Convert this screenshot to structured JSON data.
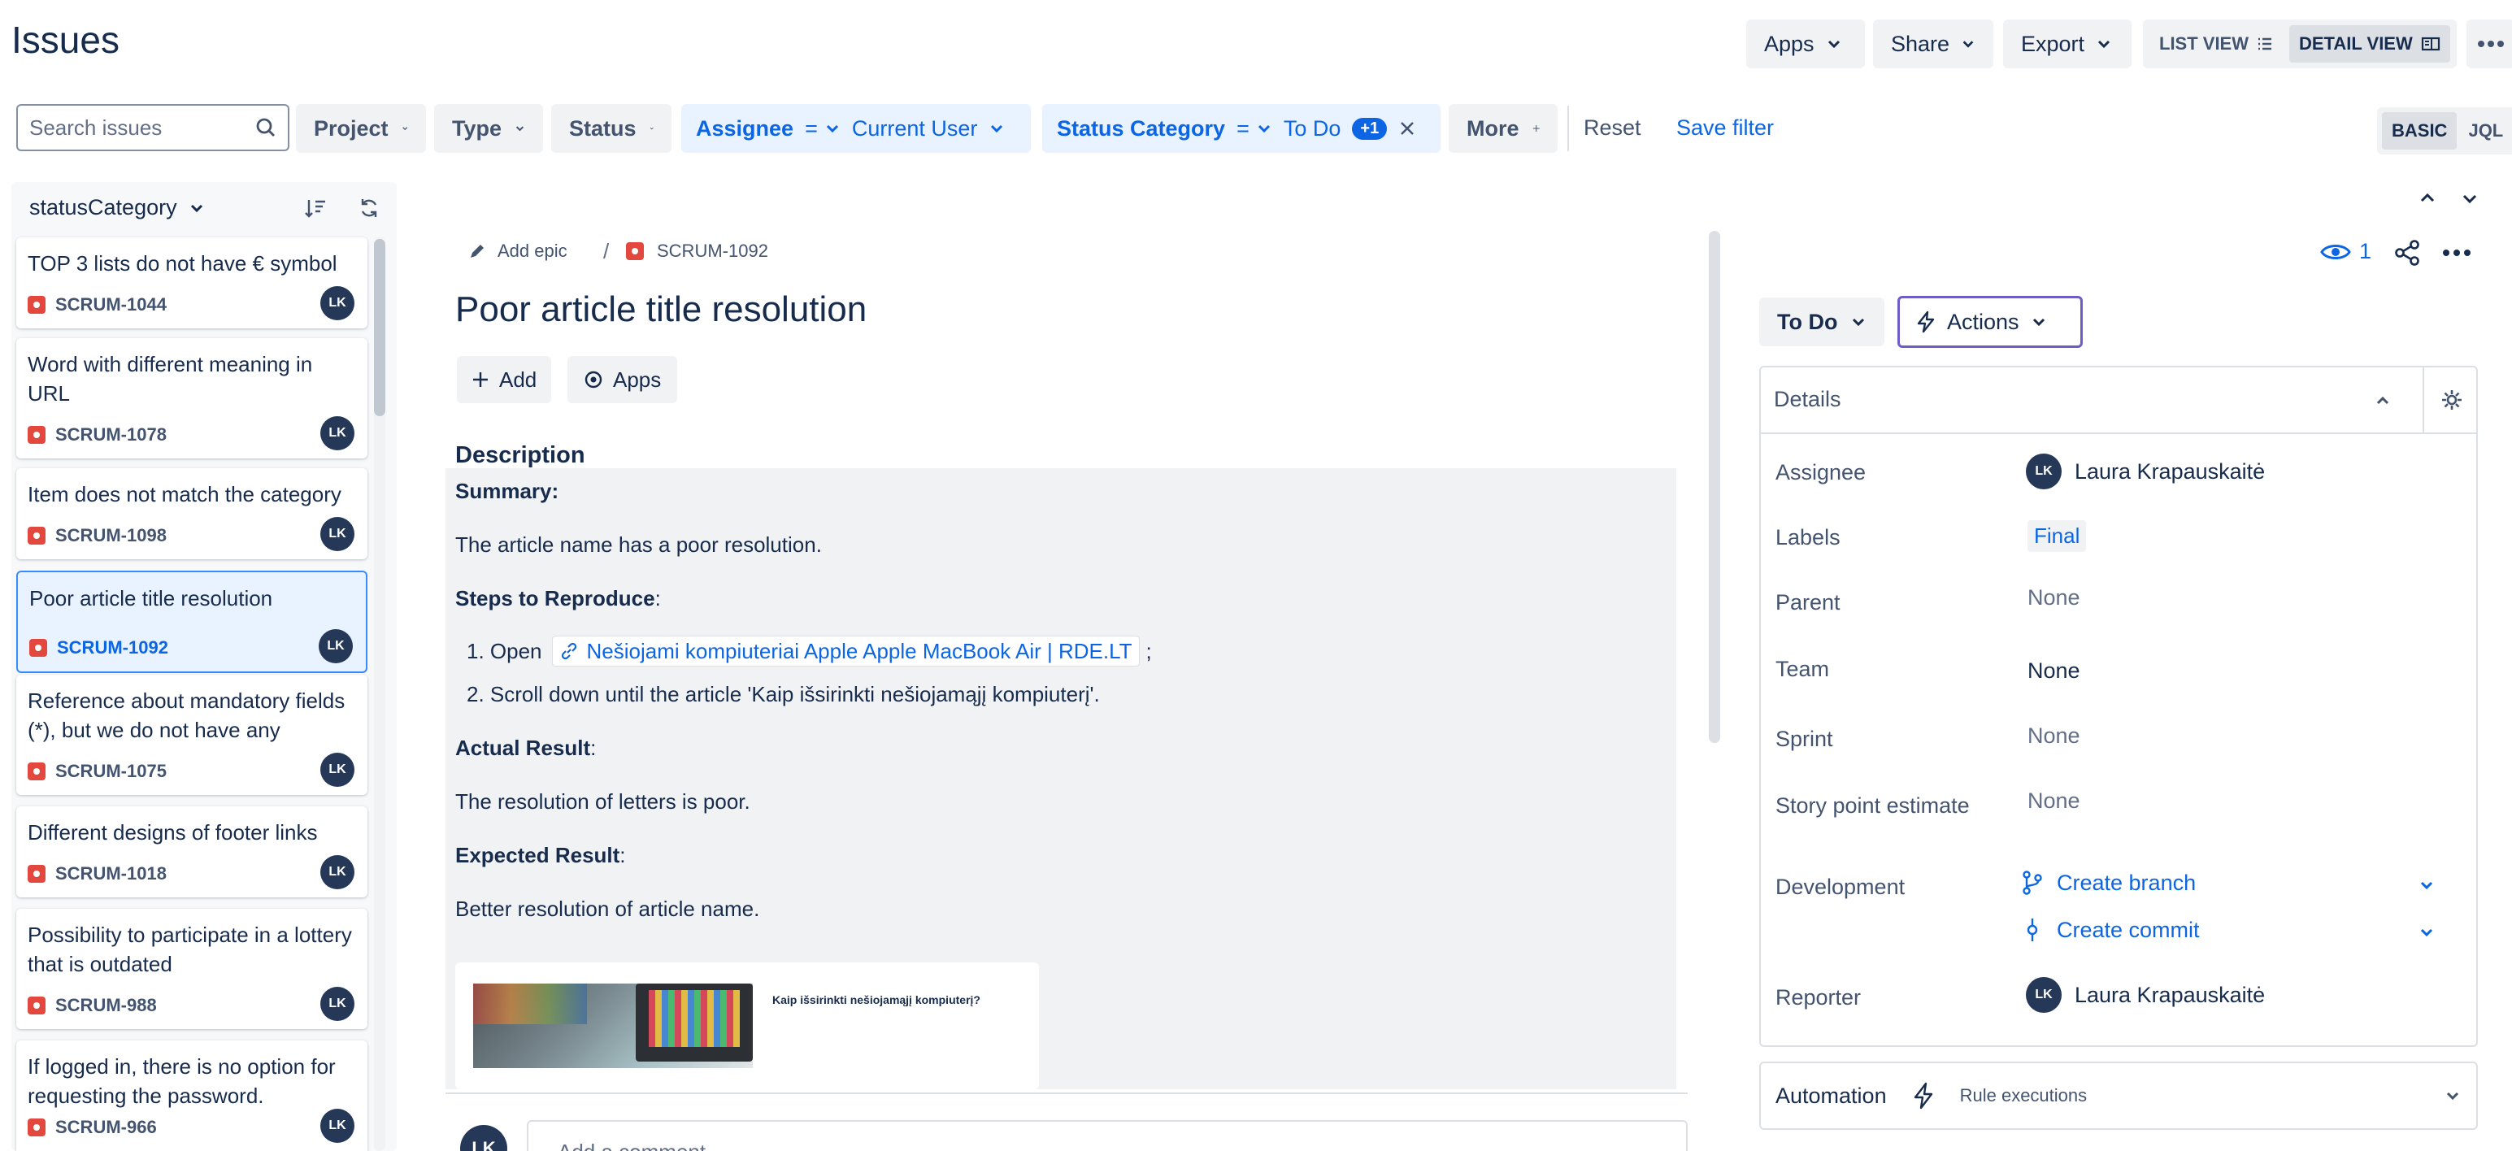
{
  "page": {
    "title": "Issues"
  },
  "top_actions": {
    "apps": "Apps",
    "share": "Share",
    "export": "Export",
    "list_view": "LIST VIEW",
    "detail_view": "DETAIL VIEW"
  },
  "filters": {
    "search_placeholder": "Search issues",
    "project": "Project",
    "type": "Type",
    "status": "Status",
    "assignee_label": "Assignee",
    "assignee_op": "=",
    "assignee_value": "Current User",
    "status_cat_label": "Status Category",
    "status_cat_op": "=",
    "status_cat_value": "To Do",
    "status_cat_extra": "+1",
    "more": "More",
    "reset": "Reset",
    "save_filter": "Save filter",
    "basic": "BASIC",
    "jql": "JQL"
  },
  "list": {
    "group_by": "statusCategory",
    "items": [
      {
        "title": "TOP 3 lists do not have € symbol",
        "key": "SCRUM-1044",
        "avatar": "LK"
      },
      {
        "title": "Word with different meaning in URL",
        "key": "SCRUM-1078",
        "avatar": "LK"
      },
      {
        "title": "Item does not match the category",
        "key": "SCRUM-1098",
        "avatar": "LK"
      },
      {
        "title": "Poor article title resolution",
        "key": "SCRUM-1092",
        "avatar": "LK"
      },
      {
        "title": "Reference about mandatory fields (*), but we do not have any",
        "key": "SCRUM-1075",
        "avatar": "LK"
      },
      {
        "title": "Different designs of footer links",
        "key": "SCRUM-1018",
        "avatar": "LK"
      },
      {
        "title": "Possibility to participate in a lottery that is outdated",
        "key": "SCRUM-988",
        "avatar": "LK"
      },
      {
        "title": "If logged in, there is no option for requesting the password.",
        "key": "SCRUM-966",
        "avatar": "LK"
      }
    ]
  },
  "issue": {
    "add_epic": "Add epic",
    "separator": "/",
    "key": "SCRUM-1092",
    "title": "Poor article title resolution",
    "add": "Add",
    "apps": "Apps",
    "description_heading": "Description",
    "summary_label": "Summary:",
    "summary_text": "The article name has a poor resolution.",
    "steps_label": "Steps to Reproduce",
    "colon": ":",
    "step1_prefix": "1. Open",
    "step1_link": "Nešiojami kompiuteriai Apple Apple MacBook Air | RDE.LT",
    "step1_suffix": ";",
    "step2": "2. Scroll down until the article 'Kaip išsirinkti nešiojamąjį kompiuterį'.",
    "actual_label": "Actual Result",
    "actual_text": "The resolution of letters is poor.",
    "expected_label": "Expected Result",
    "expected_text": "Better resolution of article name.",
    "image_caption": "Kaip išsirinkti nešiojamąjį kompiuterį?",
    "comment_avatar": "LK",
    "comment_placeholder": "Add a comment..."
  },
  "side": {
    "watch_count": "1",
    "status": "To Do",
    "actions": "Actions",
    "details_heading": "Details",
    "fields": {
      "assignee_label": "Assignee",
      "assignee_value": "Laura Krapauskaitė",
      "assignee_avatar": "LK",
      "labels_label": "Labels",
      "labels_value": "Final",
      "parent_label": "Parent",
      "parent_value": "None",
      "team_label": "Team",
      "team_value": "None",
      "sprint_label": "Sprint",
      "sprint_value": "None",
      "sp_label": "Story point estimate",
      "sp_value": "None",
      "dev_label": "Development",
      "create_branch": "Create branch",
      "create_commit": "Create commit",
      "reporter_label": "Reporter",
      "reporter_value": "Laura Krapauskaitė",
      "reporter_avatar": "LK"
    },
    "automation": "Automation",
    "rule_executions": "Rule executions"
  },
  "colors": {
    "accent": "#0c66e4",
    "selected_bg": "#e9f2ff",
    "bug": "#e2483d",
    "avatar": "#253858"
  }
}
